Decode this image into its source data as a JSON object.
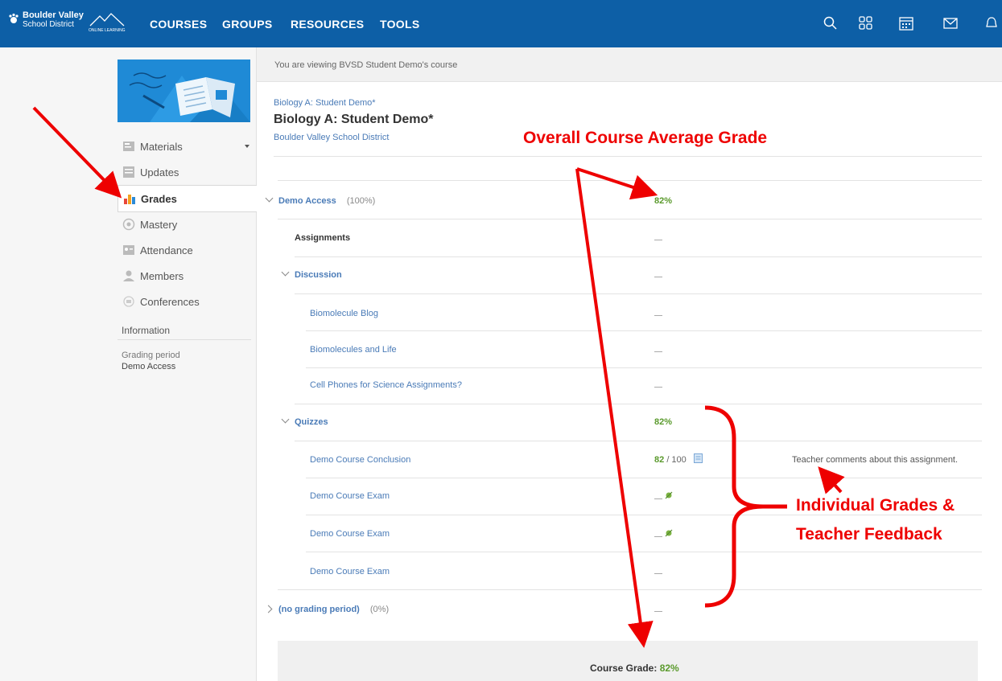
{
  "brand": {
    "line1": "Boulder Valley",
    "line2": "School District",
    "online": "ONLINE LEARNING"
  },
  "nav": [
    "COURSES",
    "GROUPS",
    "RESOURCES",
    "TOOLS"
  ],
  "topbar_icons": [
    "search-icon",
    "grid-icon",
    "calendar-icon",
    "mail-icon",
    "bell-icon"
  ],
  "sidebar": {
    "items": [
      {
        "label": "Materials",
        "icon": "materials-icon"
      },
      {
        "label": "Updates",
        "icon": "updates-icon"
      },
      {
        "label": "Grades",
        "icon": "grades-icon"
      },
      {
        "label": "Mastery",
        "icon": "mastery-icon"
      },
      {
        "label": "Attendance",
        "icon": "attendance-icon"
      },
      {
        "label": "Members",
        "icon": "members-icon"
      },
      {
        "label": "Conferences",
        "icon": "conferences-icon"
      }
    ],
    "info_heading": "Information",
    "grading_period_label": "Grading period",
    "grading_period_value": "Demo Access"
  },
  "viewing_notice": "You are viewing BVSD Student Demo's course",
  "course": {
    "breadcrumb": "Biology A: Student Demo*",
    "title": "Biology A: Student Demo*",
    "school": "Boulder Valley School District"
  },
  "gradebook": {
    "period": {
      "name": "Demo Access",
      "weight": "(100%)",
      "grade": "82%"
    },
    "assignments_label": "Assignments",
    "discussion": {
      "label": "Discussion",
      "items": [
        "Biomolecule Blog",
        "Biomolecules and Life",
        "Cell Phones for Science Assignments?"
      ]
    },
    "quizzes": {
      "label": "Quizzes",
      "grade": "82%",
      "conclusion": {
        "name": "Demo Course Conclusion",
        "score": "82",
        "max": "/ 100",
        "comment": "Teacher comments about this assignment."
      },
      "exams": [
        "Demo Course Exam",
        "Demo Course Exam",
        "Demo Course Exam"
      ]
    },
    "no_period": {
      "name": "(no grading period)",
      "weight": "(0%)"
    },
    "course_grade_label": "Course Grade:",
    "course_grade_value": "82%"
  },
  "annotations": {
    "overall": "Overall Course Average Grade",
    "individual_line1": "Individual Grades &",
    "individual_line2": "Teacher Feedback"
  },
  "colors": {
    "topbar": "#0d5fa6",
    "link": "#4a7bb7",
    "grade_green": "#5a9a2c",
    "annotation_red": "#e00000"
  }
}
